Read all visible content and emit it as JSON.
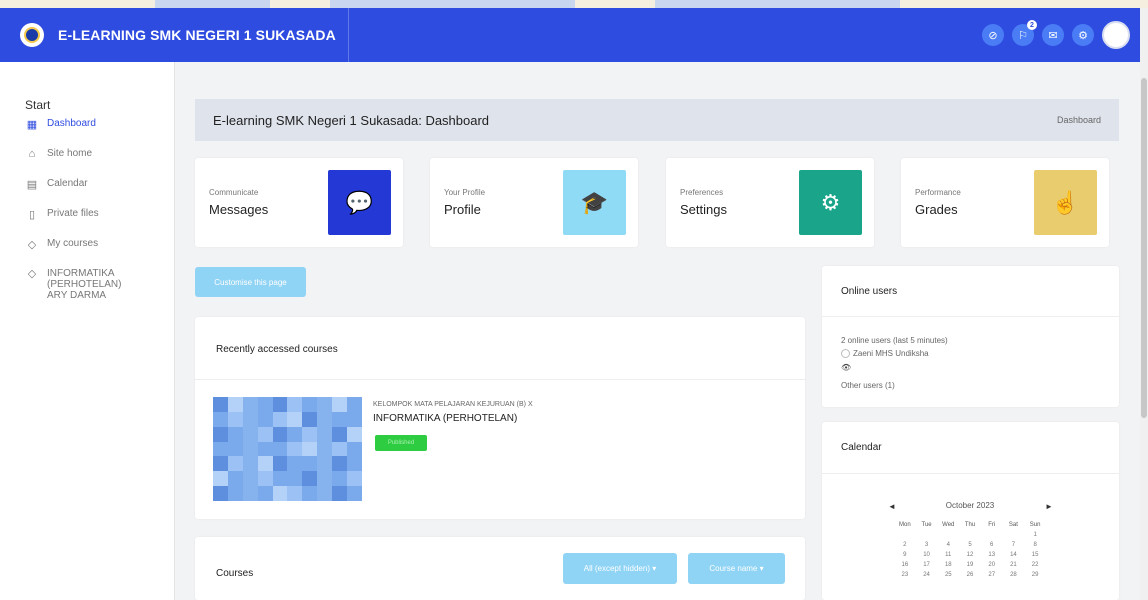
{
  "site": {
    "title": "E-LEARNING SMK NEGERI 1 SUKASADA",
    "logo_icon": "school-logo-icon"
  },
  "navbar": {
    "icons": [
      {
        "name": "hide-eye-icon",
        "glyph": "⊘"
      },
      {
        "name": "notifications-icon",
        "glyph": "⚐",
        "badge": "2"
      },
      {
        "name": "messages-icon",
        "glyph": "✉"
      },
      {
        "name": "settings-icon",
        "glyph": "⚙"
      }
    ],
    "accent": "#2f4ce0"
  },
  "sidebar": {
    "start_label": "Start",
    "items": [
      {
        "label": "Dashboard",
        "icon": "dashboard-icon",
        "glyph": "▦",
        "active": true
      },
      {
        "label": "Site home",
        "icon": "home-icon",
        "glyph": "⌂",
        "active": false
      },
      {
        "label": "Calendar",
        "icon": "calendar-icon",
        "glyph": "▤",
        "active": false
      },
      {
        "label": "Private files",
        "icon": "file-icon",
        "glyph": "▯",
        "active": false
      },
      {
        "label": "My courses",
        "icon": "graduation-cap-icon",
        "glyph": "◇",
        "active": false
      },
      {
        "label": "INFORMATIKA (PERHOTELAN) ARY DARMA",
        "icon": "graduation-cap-icon",
        "glyph": "◇",
        "active": false
      }
    ]
  },
  "header": {
    "title": "E-learning SMK Negeri 1 Sukasada: Dashboard",
    "breadcrumb": "Dashboard"
  },
  "tiles": [
    {
      "small": "Communicate",
      "big": "Messages",
      "icon": "chat-bubbles-icon",
      "glyph": "💬",
      "color": "#2438d6"
    },
    {
      "small": "Your Profile",
      "big": "Profile",
      "icon": "graduation-cap-icon",
      "glyph": "🎓",
      "color": "#8fdaf5"
    },
    {
      "small": "Preferences",
      "big": "Settings",
      "icon": "gear-icon",
      "glyph": "⚙",
      "color": "#1aa58a"
    },
    {
      "small": "Performance",
      "big": "Grades",
      "icon": "hand-stars-icon",
      "glyph": "☝",
      "color": "#e8cc6e"
    }
  ],
  "customise_button": "Customise this page",
  "recent": {
    "title": "Recently accessed courses",
    "course": {
      "category": "KELOMPOK MATA PELAJARAN KEJURUAN (B) X",
      "name": "INFORMATIKA (PERHOTELAN)",
      "badge": "Published"
    }
  },
  "courses": {
    "title": "Courses",
    "filter_label": "All (except hidden)",
    "sort_label": "Course name"
  },
  "online_users": {
    "title": "Online users",
    "summary": "2 online users (last 5 minutes)",
    "user": "Zaeni MHS Undiksha",
    "other": "Other users (1)"
  },
  "calendar": {
    "title": "Calendar",
    "month": "October 2023",
    "prev": "◄",
    "next": "►",
    "weekdays": [
      "Mon",
      "Tue",
      "Wed",
      "Thu",
      "Fri",
      "Sat",
      "Sun"
    ],
    "days": [
      "",
      "",
      "",
      "",
      "",
      "",
      "1",
      "2",
      "3",
      "4",
      "5",
      "6",
      "7",
      "8",
      "9",
      "10",
      "11",
      "12",
      "13",
      "14",
      "15",
      "16",
      "17",
      "18",
      "19",
      "20",
      "21",
      "22",
      "23",
      "24",
      "25",
      "26",
      "27",
      "28",
      "29"
    ]
  }
}
